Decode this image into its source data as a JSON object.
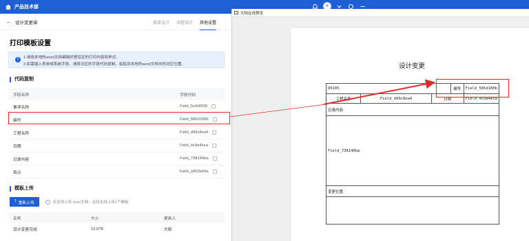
{
  "topbar": {
    "app_name": "产品技术部"
  },
  "subheader": {
    "title": "设计变更单",
    "tabs": [
      "表单设计",
      "流程设计",
      "其他设置"
    ],
    "active_tab": 2
  },
  "main": {
    "section_title": "打印模板设置",
    "notice": {
      "line1": "1.请用本地的word文档编辑好想设定的打印内容和样式;",
      "line2": "2.如需插入表单或系统字段，请将对应的字段代码复制，粘贴到本地的word文档中的对应位置。"
    },
    "code_section": {
      "title": "代码复制",
      "col_name": "字段名称",
      "col_code": "字段代码",
      "rows": [
        {
          "name": "事项名称",
          "code": "Field_5e9df339"
        },
        {
          "name": "编号",
          "code": "Field_585d180b"
        },
        {
          "name": "工程名称",
          "code": "Field_d99c8ea4"
        },
        {
          "name": "日期",
          "code": "Field_4c9a4eca"
        },
        {
          "name": "记录内容",
          "code": "Field_738140ba"
        },
        {
          "name": "现点",
          "code": "Field_a903eb9a"
        }
      ]
    },
    "upload_section": {
      "title": "模板上传",
      "button": "重新上传",
      "tip": "仅支持上传.docx文档，且仅支持上传1个模板",
      "col_name": "名称",
      "col_size": "大小",
      "col_user": "更新人",
      "file": {
        "name": "设计变更完成",
        "size": "12.07K",
        "user": "大辉"
      }
    }
  },
  "preview": {
    "window_title": "文档在线预览",
    "doc_title": "设计变更",
    "table": {
      "code": "D0105",
      "number_label": "编号",
      "number_value": "Field_585d180b",
      "project_label": "工程名称",
      "project_value": "Field_d99c8ea4",
      "date_label": "日期",
      "date_value": "Field_4c9a4eca",
      "record_label": "记录内容:",
      "record_value": "Field_738140ba",
      "position_label": "变更位置:"
    }
  },
  "colors": {
    "brand": "#1f5fd6",
    "highlight": "#e22b2b"
  }
}
